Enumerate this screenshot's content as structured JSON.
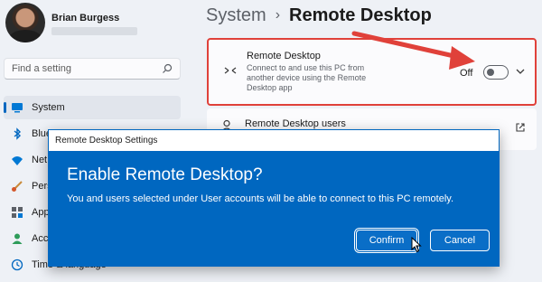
{
  "user": {
    "name": "Brian Burgess"
  },
  "search": {
    "placeholder": "Find a setting",
    "icon": "search-icon"
  },
  "sidebar": {
    "items": [
      {
        "label": "System",
        "icon": "monitor-icon",
        "active": true
      },
      {
        "label": "Blue",
        "icon": "bluetooth-icon",
        "active": false
      },
      {
        "label": "Net",
        "icon": "wifi-icon",
        "active": false
      },
      {
        "label": "Pers",
        "icon": "brush-icon",
        "active": false
      },
      {
        "label": "App",
        "icon": "apps-icon",
        "active": false
      },
      {
        "label": "Acc",
        "icon": "person-icon",
        "active": false
      },
      {
        "label": "Time & language",
        "icon": "globe-clock-icon",
        "active": false
      }
    ]
  },
  "header": {
    "breadcrumb": "System",
    "separator": "›",
    "title": "Remote Desktop"
  },
  "remote_desktop_card": {
    "title": "Remote Desktop",
    "description": "Connect to and use this PC from another device using the Remote Desktop app",
    "toggle_label": "Off",
    "toggle_on": false
  },
  "users_card": {
    "title": "Remote Desktop users"
  },
  "dialog": {
    "window_title": "Remote Desktop Settings",
    "heading": "Enable Remote Desktop?",
    "body": "You and users selected under User accounts will be able to connect to this PC remotely.",
    "confirm_label": "Confirm",
    "cancel_label": "Cancel"
  },
  "colors": {
    "accent": "#0067c0",
    "highlight_border": "#e0413a",
    "window_bg": "#eef1f6",
    "card_bg": "#fbfbfd"
  }
}
